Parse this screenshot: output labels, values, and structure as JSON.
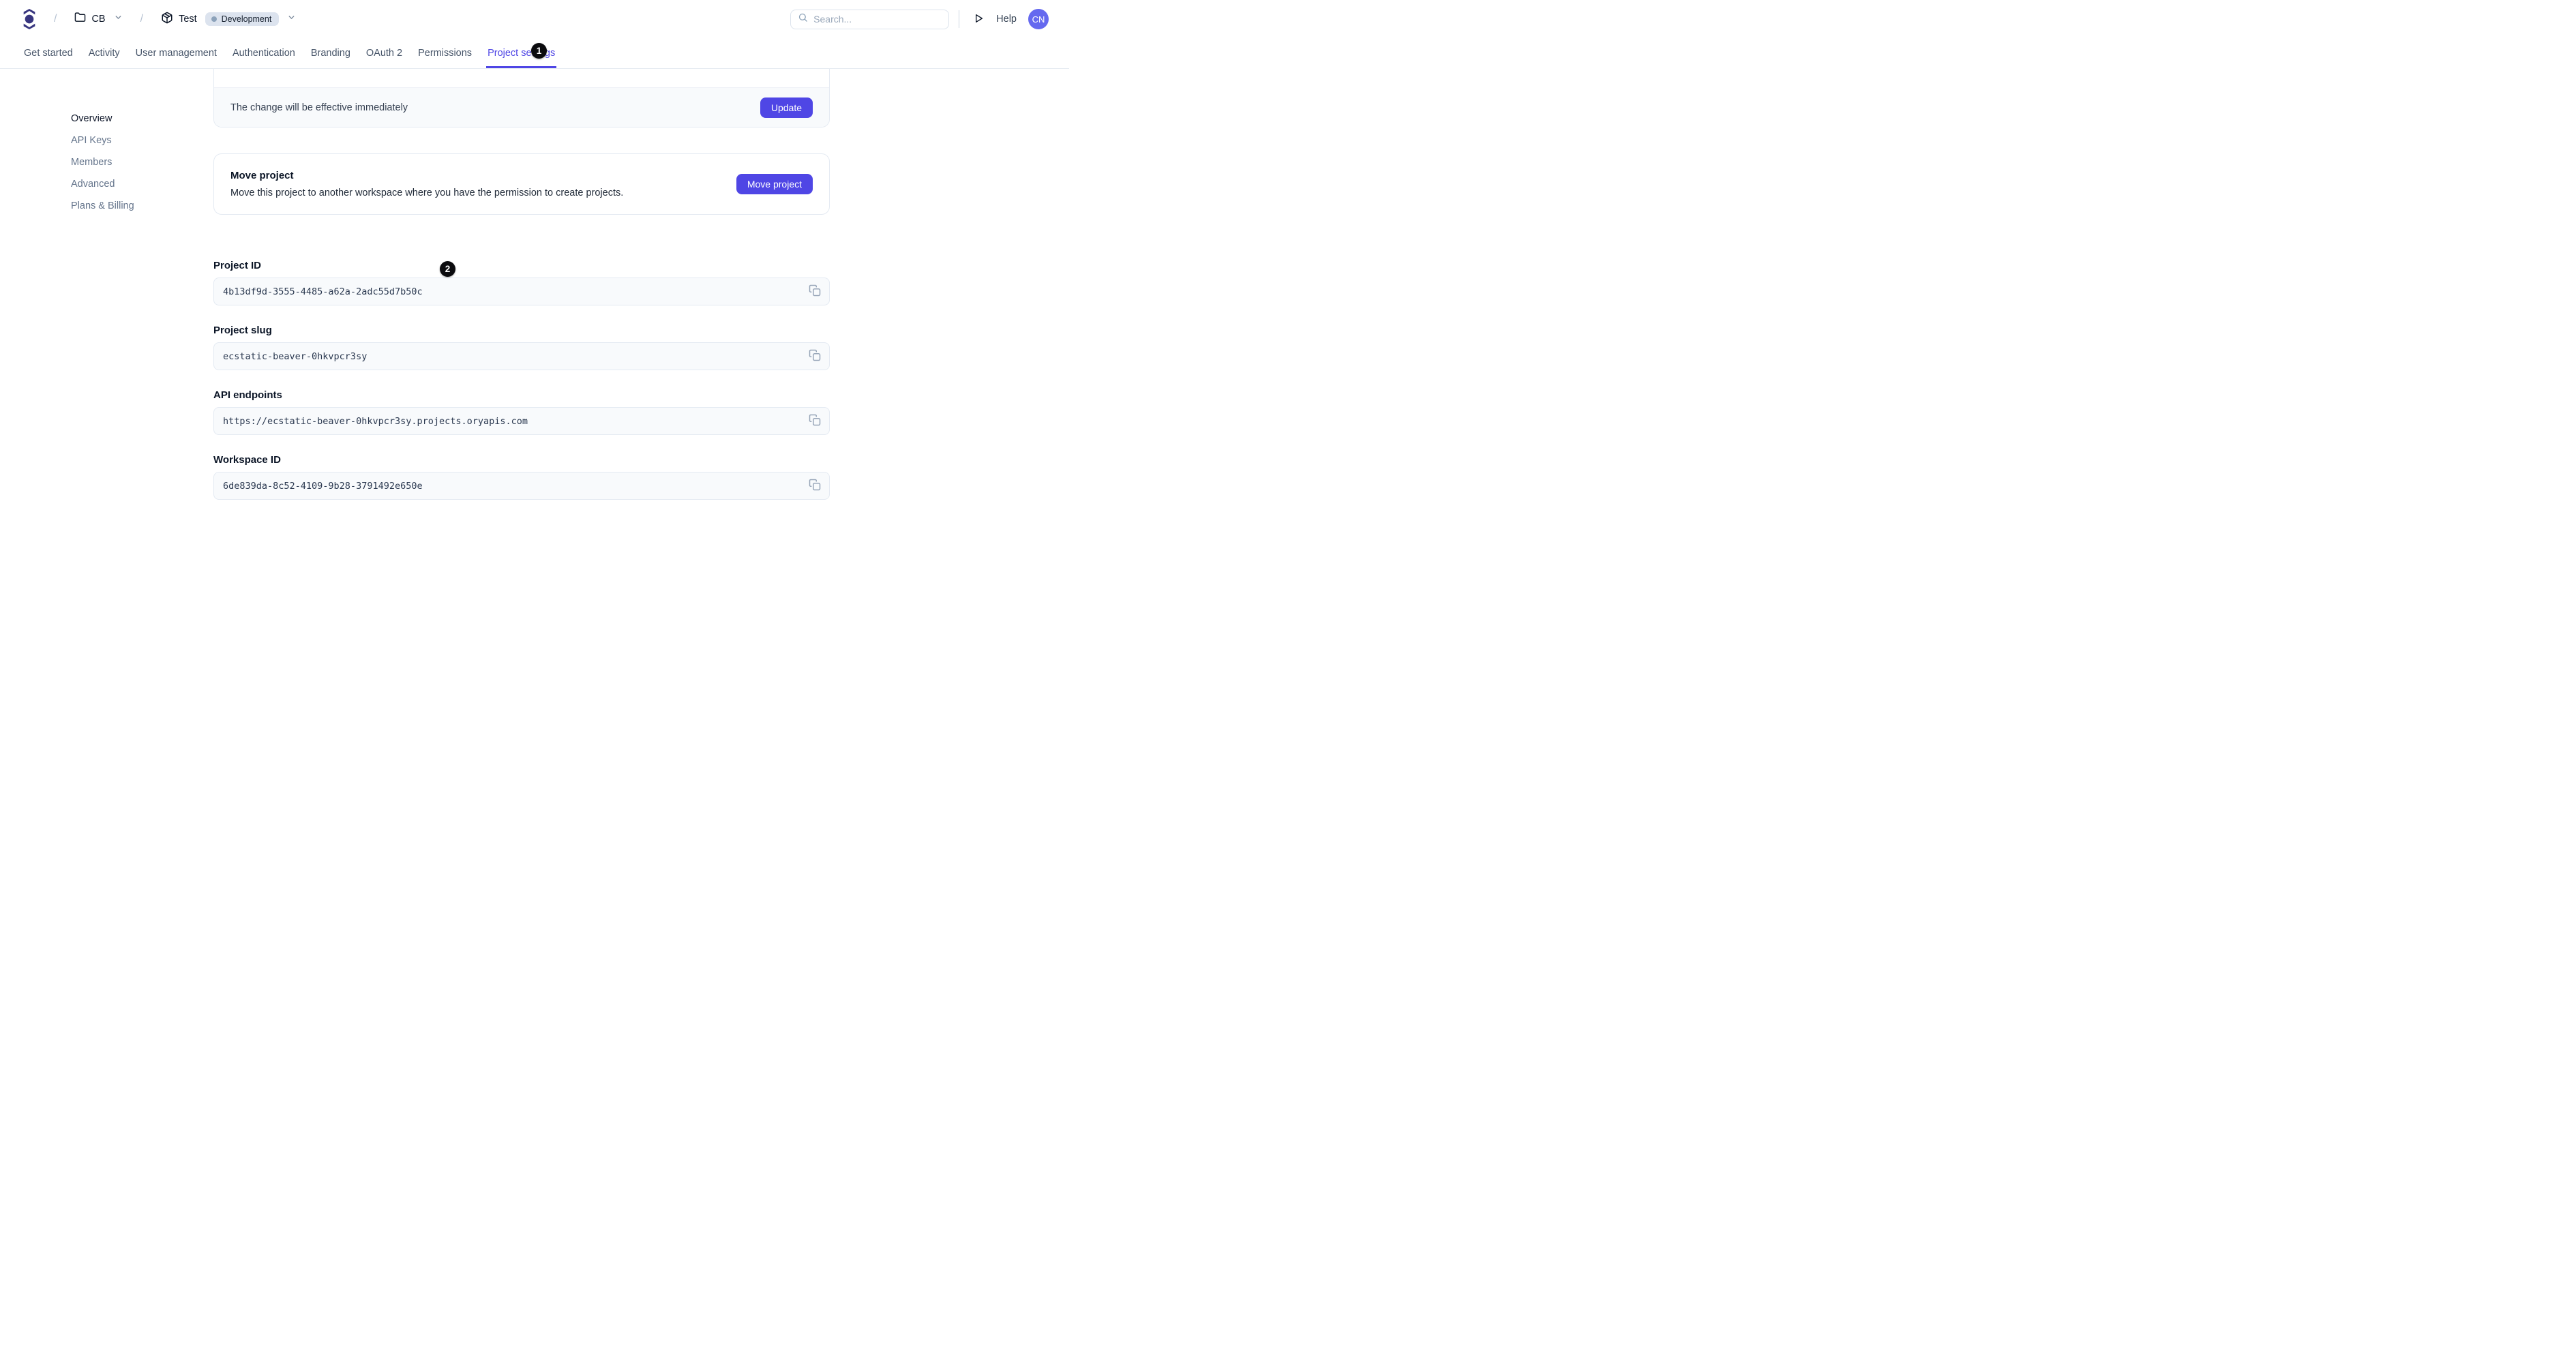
{
  "header": {
    "breadcrumb": {
      "separator": "/",
      "workspace": {
        "label": "CB"
      },
      "project": {
        "label": "Test",
        "env_badge": "Development"
      }
    },
    "search": {
      "placeholder": "Search..."
    },
    "help_label": "Help",
    "avatar_initials": "CN"
  },
  "tabs": [
    {
      "label": "Get started",
      "active": false
    },
    {
      "label": "Activity",
      "active": false
    },
    {
      "label": "User management",
      "active": false
    },
    {
      "label": "Authentication",
      "active": false
    },
    {
      "label": "Branding",
      "active": false
    },
    {
      "label": "OAuth 2",
      "active": false
    },
    {
      "label": "Permissions",
      "active": false
    },
    {
      "label": "Project settings",
      "active": true
    }
  ],
  "annotations": {
    "badge1": "1",
    "badge2": "2"
  },
  "sidebar": {
    "items": [
      {
        "label": "Overview",
        "active": true
      },
      {
        "label": "API Keys",
        "active": false
      },
      {
        "label": "Members",
        "active": false
      },
      {
        "label": "Advanced",
        "active": false
      },
      {
        "label": "Plans & Billing",
        "active": false
      }
    ]
  },
  "update_card": {
    "message": "The change will be effective immediately",
    "button_label": "Update"
  },
  "move_card": {
    "title": "Move project",
    "description": "Move this project to another workspace where you have the permission to create projects.",
    "button_label": "Move project"
  },
  "fields": [
    {
      "label": "Project ID",
      "value": "4b13df9d-3555-4485-a62a-2adc55d7b50c"
    },
    {
      "label": "Project slug",
      "value": "ecstatic-beaver-0hkvpcr3sy"
    },
    {
      "label": "API endpoints",
      "value": "https://ecstatic-beaver-0hkvpcr3sy.projects.oryapis.com"
    },
    {
      "label": "Workspace ID",
      "value": "6de839da-8c52-4109-9b28-3791492e650e"
    }
  ],
  "colors": {
    "accent": "#4f46e5",
    "logo": "#37357f",
    "avatar_bg": "#6569ef",
    "env_badge_bg": "#dce3ee",
    "field_bg": "#f8fafc",
    "border": "#e4eaf2",
    "annotation_bg": "#0b0b0e"
  }
}
